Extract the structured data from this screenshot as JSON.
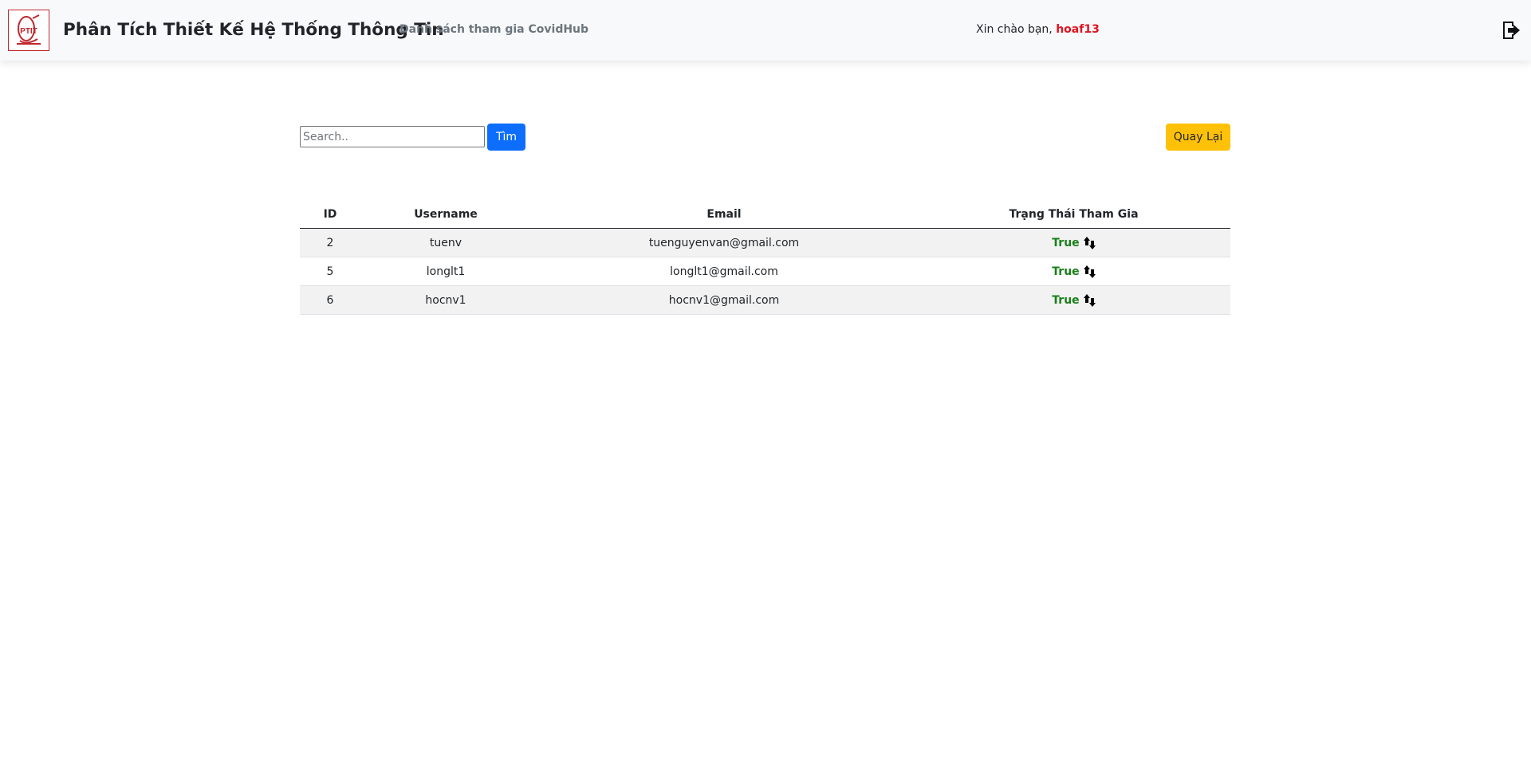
{
  "header": {
    "logo_text": "PTIT",
    "brand": "Phân Tích Thiết Kế Hệ Thống Thông Tin",
    "nav_link": "Danh sách tham gia CovidHub",
    "greeting_prefix": "Xin chào bạn,",
    "username": "hoaf13",
    "logout_icon": "sign-out-icon"
  },
  "toolbar": {
    "search_placeholder": "Search..",
    "search_value": "",
    "search_button": "Tìm",
    "back_button": "Quay Lại"
  },
  "table": {
    "columns": [
      "ID",
      "Username",
      "Email",
      "Trạng Thái Tham Gia"
    ],
    "rows": [
      {
        "id": "2",
        "username": "tuenv",
        "email": "tuenguyenvan@gmail.com",
        "status": "True"
      },
      {
        "id": "5",
        "username": "longlt1",
        "email": "longlt1@gmail.com",
        "status": "True"
      },
      {
        "id": "6",
        "username": "hocnv1",
        "email": "hocnv1@gmail.com",
        "status": "True"
      }
    ],
    "toggle_icon": "sort-toggle-icon"
  },
  "colors": {
    "primary": "#0d6efd",
    "warning": "#ffc107",
    "status_true": "#198019",
    "username_highlight": "#e0131f"
  }
}
